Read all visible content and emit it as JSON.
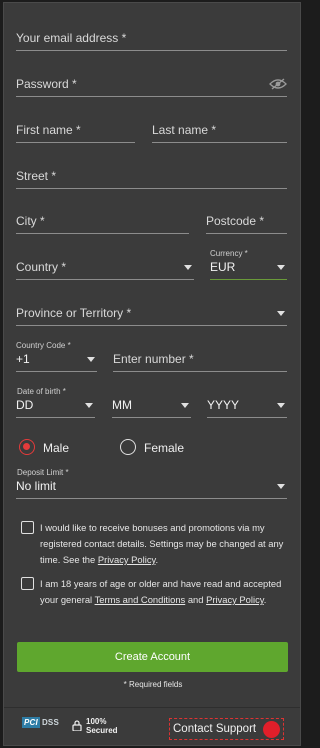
{
  "form": {
    "email_placeholder": "Your email address *",
    "password_placeholder": "Password *",
    "first_name_placeholder": "First name *",
    "last_name_placeholder": "Last name *",
    "street_placeholder": "Street *",
    "city_placeholder": "City *",
    "postcode_placeholder": "Postcode *",
    "country_placeholder": "Country *",
    "currency_label": "Currency *",
    "currency_value": "EUR",
    "province_placeholder": "Province or Territory *",
    "country_code_label": "Country Code *",
    "country_code_value": "+1",
    "phone_placeholder": "Enter number *",
    "dob_label": "Date of birth *",
    "dob_day": "DD",
    "dob_month": "MM",
    "dob_year": "YYYY",
    "gender_male": "Male",
    "gender_female": "Female",
    "deposit_limit_label": "Deposit Limit *",
    "deposit_limit_value": "No limit",
    "bonus_text_1": "I would like to receive bonuses and promotions via my registered contact details. Settings may be changed at any time. See the ",
    "bonus_link": "Privacy Policy",
    "bonus_text_2": ".",
    "age_text_1": "I am 18 years of age or older and have read and accepted your general ",
    "age_link_terms": "Terms and Conditions",
    "age_text_2": " and ",
    "age_link_privacy": "Privacy Policy",
    "age_text_3": ".",
    "submit_label": "Create Account",
    "required_note": "* Required fields"
  },
  "footer": {
    "pci_mark": "PCI",
    "pci_text": "DSS",
    "secured_top": "100%",
    "secured_bottom": "Secured",
    "support_label": "Contact Support"
  },
  "colors": {
    "background": "#3b3b3b",
    "accent_green": "#5fa72e",
    "radio_red": "#e43b3b",
    "support_red": "#e11f2a"
  }
}
